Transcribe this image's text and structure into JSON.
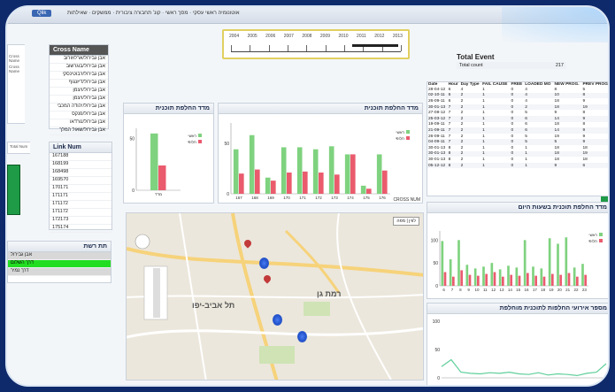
{
  "window": {
    "app_tab": "Qlik",
    "tabs_text": "אוטונומיה ראשי עסקי · מסך ראשי · קונ' תחבורה ציבורית · ממשקים · שאילתות"
  },
  "timeline": {
    "years": [
      "2004",
      "2005",
      "2006",
      "2007",
      "2008",
      "2009",
      "2010",
      "2011",
      "2012",
      "2013"
    ]
  },
  "cross_name": {
    "header": "Cross Name",
    "side_labels": [
      "Cross Name",
      "Cross Name"
    ],
    "items": [
      "אבן גבירול/ארלוזורוב",
      "אבן גבירול/בוגרשוב",
      "אבן גבירול/ז'בוטינסקי",
      "אבן גבירול/דיזנגוף",
      "אבן גבירול/ויצמן",
      "אבן גבירול/ויצמן",
      "אבן גבירול/יהודה המכבי",
      "אבן גבירול/פנקס",
      "אבן גבירול/נורדאו",
      "אבן גבירול/שאול המלך"
    ]
  },
  "link_num": {
    "header": "Link Num",
    "side_label": "Total Num",
    "items": [
      "167188",
      "168199",
      "168498",
      "169570",
      "170171",
      "171171",
      "171172",
      "171172",
      "172173",
      "175174"
    ]
  },
  "street_list": {
    "header": "תת רשת",
    "items": [
      "אבן גבירול",
      "דרך השלום",
      "דרך נמיר"
    ],
    "selected_index": 1
  },
  "total_event": {
    "title": "Total Event",
    "label": "Total count",
    "value": "217"
  },
  "events_table": {
    "columns": [
      "Date",
      "Hour",
      "Day Type",
      "FAIL CAUSE",
      "FREE",
      "LOADED MO",
      "NEW PROG.",
      "PREV PROG"
    ],
    "rows": [
      [
        "28-04-12",
        "6",
        "4",
        "1",
        "0",
        "4",
        "8",
        "5"
      ],
      [
        "02-10-11",
        "6",
        "2",
        "1",
        "0",
        "4",
        "10",
        "8"
      ],
      [
        "26-09-11",
        "6",
        "2",
        "1",
        "0",
        "4",
        "18",
        "9"
      ],
      [
        "30-01-13",
        "7",
        "2",
        "1",
        "0",
        "2",
        "18",
        "19"
      ],
      [
        "27-08-12",
        "7",
        "2",
        "1",
        "0",
        "5",
        "9",
        "8"
      ],
      [
        "25-03-12",
        "7",
        "2",
        "1",
        "0",
        "6",
        "14",
        "9"
      ],
      [
        "19-09-11",
        "7",
        "2",
        "1",
        "0",
        "6",
        "18",
        "8"
      ],
      [
        "21-09-11",
        "7",
        "2",
        "1",
        "0",
        "6",
        "14",
        "9"
      ],
      [
        "26-09-11",
        "7",
        "2",
        "1",
        "0",
        "5",
        "19",
        "9"
      ],
      [
        "04-09-11",
        "7",
        "2",
        "1",
        "0",
        "5",
        "5",
        "9"
      ],
      [
        "30-01-13",
        "8",
        "2",
        "1",
        "0",
        "1",
        "18",
        "18"
      ],
      [
        "30-01-13",
        "8",
        "2",
        "1",
        "0",
        "1",
        "18",
        "19"
      ],
      [
        "30-01-13",
        "8",
        "2",
        "1",
        "0",
        "1",
        "18",
        "18"
      ],
      [
        "05-12-12",
        "8",
        "2",
        "1",
        "0",
        "1",
        "9",
        "6"
      ]
    ]
  },
  "chart_small": {
    "title": "מדד החלפת תוכנית"
  },
  "chart_cross": {
    "title": "מדד החלפת תוכנית",
    "footer": "CROSS NUM"
  },
  "chart_hours": {
    "title": "מדד החלפת תוכנית בשעות היום"
  },
  "chart_line": {
    "title": "מספר אירועי החלפות לתוכנית מוחלפת"
  },
  "legend": {
    "a": "ראשי",
    "b": "חלופי",
    "color_a": "#7fd27f",
    "color_b": "#ea5b6e"
  },
  "map": {
    "labels": [
      "תל אביב-יפו",
      "רמת גן"
    ],
    "map_type_a": "מפה",
    "map_type_b": "לווין"
  },
  "chart_data": [
    {
      "type": "bar",
      "title": "מדד החלפת תוכנית",
      "categories": [
        "מדד"
      ],
      "ylim": [
        0,
        60
      ],
      "yticks": [
        0,
        50
      ],
      "series": [
        {
          "name": "ראשי",
          "values": [
            55
          ]
        },
        {
          "name": "חלופי",
          "values": [
            24
          ]
        }
      ]
    },
    {
      "type": "bar",
      "title": "מדד החלפת תוכנית",
      "categories": [
        "167",
        "168",
        "169",
        "170",
        "171",
        "172",
        "173",
        "174",
        "175",
        "176"
      ],
      "ylim": [
        0,
        70
      ],
      "yticks": [
        0,
        50
      ],
      "series": [
        {
          "name": "ראשי",
          "values": [
            44,
            58,
            16,
            46,
            46,
            44,
            47,
            39,
            8,
            39
          ]
        },
        {
          "name": "חלופי",
          "values": [
            20,
            24,
            13,
            21,
            22,
            21,
            19,
            39,
            5,
            23
          ]
        }
      ]
    },
    {
      "type": "bar",
      "title": "מדד החלפת תוכנית בשעות היום",
      "categories": [
        "6",
        "7",
        "8",
        "9",
        "10",
        "11",
        "12",
        "13",
        "14",
        "15",
        "16",
        "17",
        "18",
        "19",
        "20",
        "21",
        "22",
        "23"
      ],
      "ylim": [
        0,
        120
      ],
      "yticks": [
        0,
        50,
        100
      ],
      "series": [
        {
          "name": "ראשי",
          "values": [
            98,
            58,
            100,
            46,
            38,
            42,
            50,
            36,
            44,
            40,
            100,
            42,
            38,
            104,
            92,
            106,
            40,
            48
          ]
        },
        {
          "name": "חלופי",
          "values": [
            30,
            20,
            34,
            24,
            22,
            26,
            30,
            20,
            24,
            22,
            28,
            22,
            20,
            26,
            24,
            28,
            20,
            24
          ]
        }
      ]
    },
    {
      "type": "line",
      "title": "מספר אירועי החלפות לתוכנית מוחלפת",
      "ylim": [
        0,
        100
      ],
      "yticks": [
        0,
        50,
        100
      ],
      "series": [
        {
          "values": [
            20,
            32,
            10,
            8,
            7,
            9,
            8,
            10,
            7,
            6,
            9,
            5,
            7,
            6,
            4,
            8,
            10,
            25
          ]
        }
      ]
    }
  ]
}
